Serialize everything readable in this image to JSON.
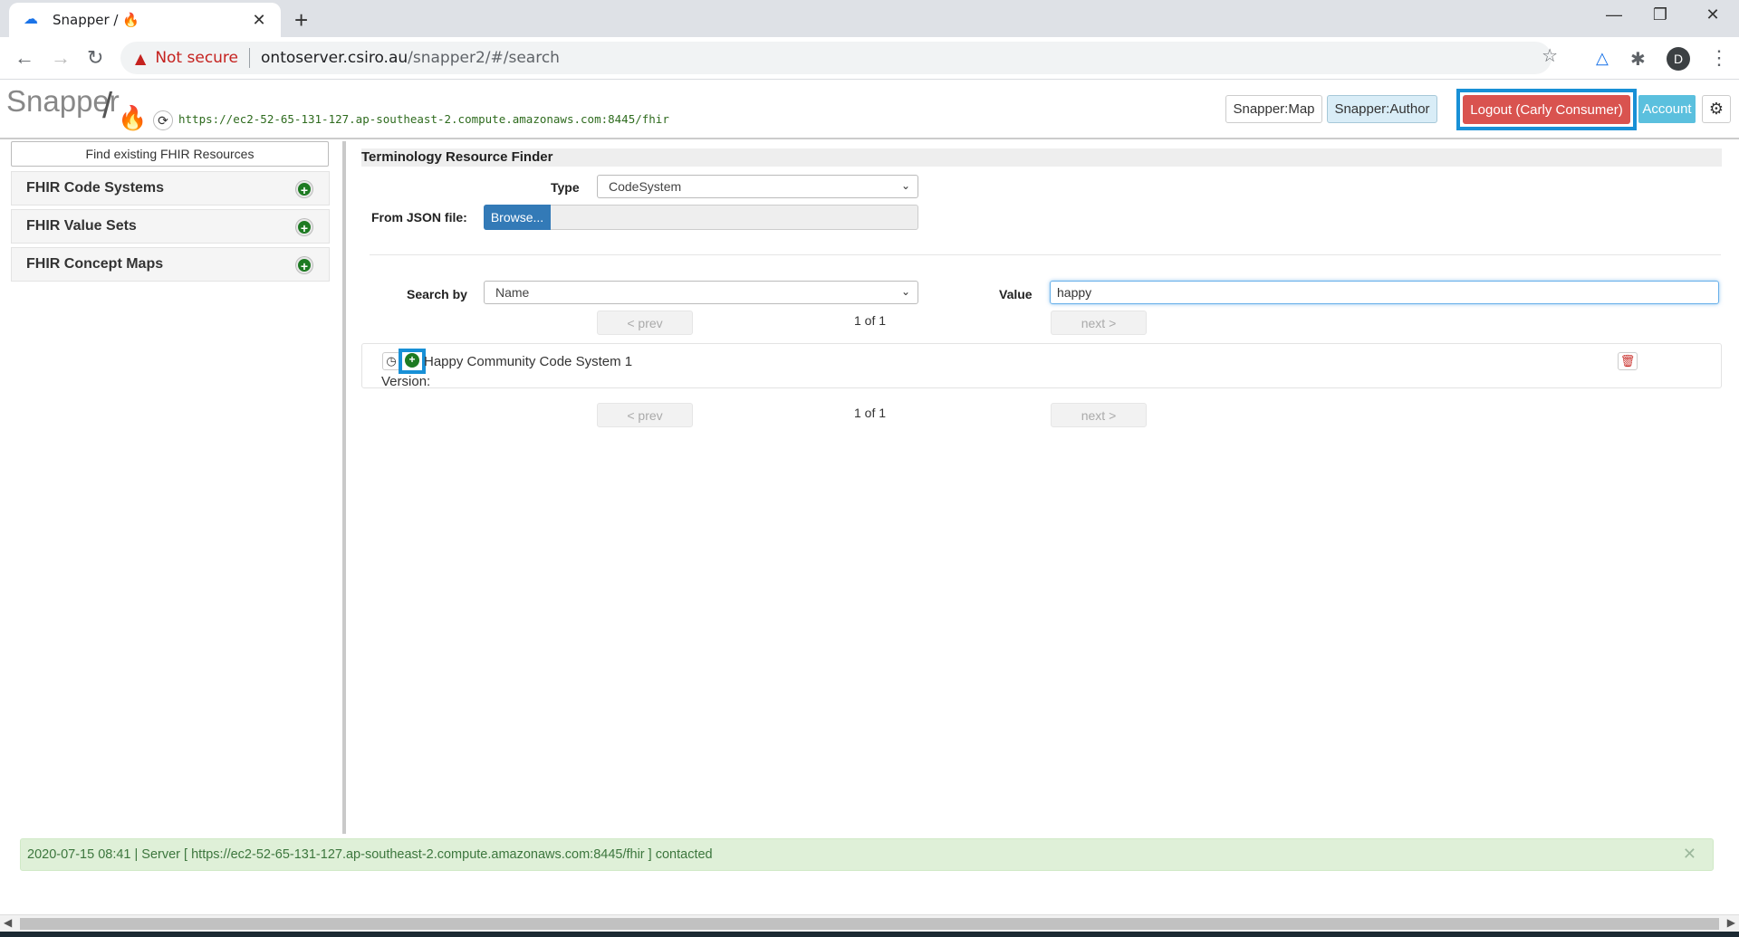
{
  "browser": {
    "tab_title": "Snapper / 🔥",
    "tab_favicon": "cloud-icon",
    "security_label": "Not secure",
    "url_host": "ontoserver.csiro.au",
    "url_path": "/snapper2/#/search",
    "profile_initial": "D"
  },
  "header": {
    "logo_text": "Snapper",
    "server_url": "https://ec2-52-65-131-127.ap-southeast-2.compute.amazonaws.com:8445/fhir",
    "map_button": "Snapper:Map",
    "author_button": "Snapper:Author",
    "logout_button": "Logout (Carly Consumer)",
    "account_button": "Account"
  },
  "sidebar": {
    "find_button": "Find existing FHIR Resources",
    "items": [
      {
        "label": "FHIR Code Systems"
      },
      {
        "label": "FHIR Value Sets"
      },
      {
        "label": "FHIR Concept Maps"
      }
    ]
  },
  "finder": {
    "title": "Terminology Resource Finder",
    "type_label": "Type",
    "type_value": "CodeSystem",
    "json_label": "From JSON file:",
    "browse_label": "Browse...",
    "search_by_label": "Search by",
    "search_by_value": "Name",
    "value_label": "Value",
    "value_input": "happy",
    "prev_label": "< prev",
    "next_label": "next >",
    "page_text": "1 of 1"
  },
  "results": [
    {
      "name": "Happy Community Code System 1",
      "version_label": "Version:"
    }
  ],
  "status": {
    "message": "2020-07-15 08:41 | Server [ https://ec2-52-65-131-127.ap-southeast-2.compute.amazonaws.com:8445/fhir ] contacted"
  },
  "colors": {
    "logout": "#d9534f",
    "account": "#5bc0de",
    "browse": "#337ab7",
    "highlight_frame": "#1890d6",
    "add_green": "#1d7a22",
    "alert_bg": "#dff0d8"
  }
}
